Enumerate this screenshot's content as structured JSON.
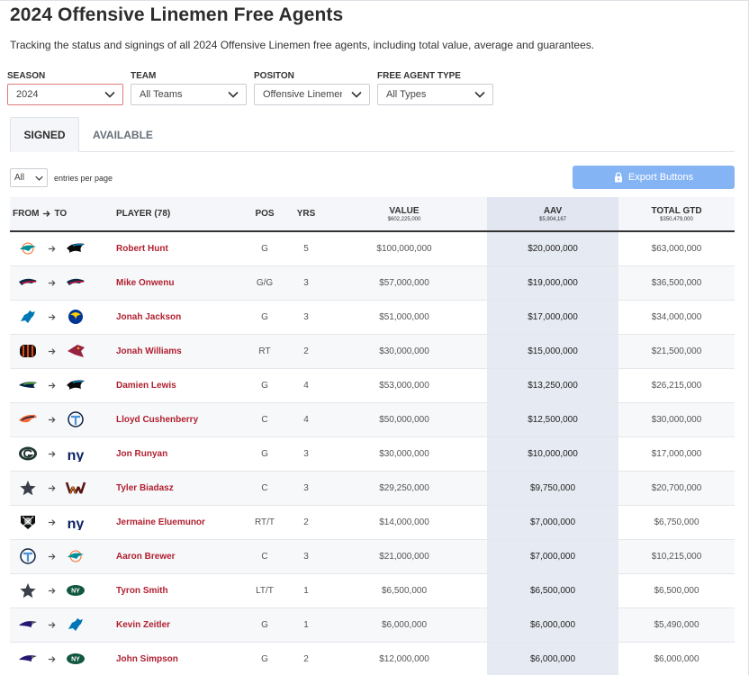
{
  "title": "2024 Offensive Linemen Free Agents",
  "description": "Tracking the status and signings of all 2024 Offensive Linemen free agents, including total value, average and guarantees.",
  "filters": [
    {
      "label": "SEASON",
      "value": "2024"
    },
    {
      "label": "TEAM",
      "value": "All Teams"
    },
    {
      "label": "POSITON",
      "value": "Offensive Linemen"
    },
    {
      "label": "FREE AGENT TYPE",
      "value": "All Types"
    }
  ],
  "tabs": {
    "signed": "SIGNED",
    "available": "AVAILABLE"
  },
  "entries": {
    "value": "All",
    "label": "entries per page"
  },
  "export_label": "Export Buttons",
  "columns": {
    "from": "FROM",
    "to": "TO",
    "player": "PLAYER (78)",
    "pos": "POS",
    "yrs": "YRS",
    "value": "VALUE",
    "value_total": "$602,225,000",
    "aav": "AAV",
    "aav_total": "$5,904,167",
    "gtd": "TOTAL GTD",
    "gtd_total": "$350,479,000"
  },
  "colors": {
    "accent_red": "#b02030",
    "export_blue": "#85b4f5",
    "aav_column": "#e6eaf2"
  },
  "rows": [
    {
      "from": "dolphins",
      "to": "panthers",
      "player": "Robert Hunt",
      "pos": "G",
      "yrs": "5",
      "value": "$100,000,000",
      "aav": "$20,000,000",
      "gtd": "$63,000,000"
    },
    {
      "from": "patriots",
      "to": "patriots",
      "player": "Mike Onwenu",
      "pos": "G/G",
      "yrs": "3",
      "value": "$57,000,000",
      "aav": "$19,000,000",
      "gtd": "$36,500,000"
    },
    {
      "from": "lions",
      "to": "rams",
      "player": "Jonah Jackson",
      "pos": "G",
      "yrs": "3",
      "value": "$51,000,000",
      "aav": "$17,000,000",
      "gtd": "$34,000,000"
    },
    {
      "from": "bengals",
      "to": "cardinals",
      "player": "Jonah Williams",
      "pos": "RT",
      "yrs": "2",
      "value": "$30,000,000",
      "aav": "$15,000,000",
      "gtd": "$21,500,000"
    },
    {
      "from": "seahawks",
      "to": "panthers",
      "player": "Damien Lewis",
      "pos": "G",
      "yrs": "4",
      "value": "$53,000,000",
      "aav": "$13,250,000",
      "gtd": "$26,215,000"
    },
    {
      "from": "broncos",
      "to": "titans",
      "player": "Lloyd Cushenberry",
      "pos": "C",
      "yrs": "4",
      "value": "$50,000,000",
      "aav": "$12,500,000",
      "gtd": "$30,000,000"
    },
    {
      "from": "packers",
      "to": "giants",
      "player": "Jon Runyan",
      "pos": "G",
      "yrs": "3",
      "value": "$30,000,000",
      "aav": "$10,000,000",
      "gtd": "$17,000,000"
    },
    {
      "from": "cowboys",
      "to": "commanders",
      "player": "Tyler Biadasz",
      "pos": "C",
      "yrs": "3",
      "value": "$29,250,000",
      "aav": "$9,750,000",
      "gtd": "$20,700,000"
    },
    {
      "from": "raiders",
      "to": "giants",
      "player": "Jermaine Eluemunor",
      "pos": "RT/T",
      "yrs": "2",
      "value": "$14,000,000",
      "aav": "$7,000,000",
      "gtd": "$6,750,000"
    },
    {
      "from": "titans",
      "to": "dolphins",
      "player": "Aaron Brewer",
      "pos": "C",
      "yrs": "3",
      "value": "$21,000,000",
      "aav": "$7,000,000",
      "gtd": "$10,215,000"
    },
    {
      "from": "cowboys",
      "to": "jets",
      "player": "Tyron Smith",
      "pos": "LT/T",
      "yrs": "1",
      "value": "$6,500,000",
      "aav": "$6,500,000",
      "gtd": "$6,500,000"
    },
    {
      "from": "ravens",
      "to": "lions",
      "player": "Kevin Zeitler",
      "pos": "G",
      "yrs": "1",
      "value": "$6,000,000",
      "aav": "$6,000,000",
      "gtd": "$5,490,000"
    },
    {
      "from": "ravens",
      "to": "jets",
      "player": "John Simpson",
      "pos": "G",
      "yrs": "2",
      "value": "$12,000,000",
      "aav": "$6,000,000",
      "gtd": "$6,000,000"
    }
  ]
}
